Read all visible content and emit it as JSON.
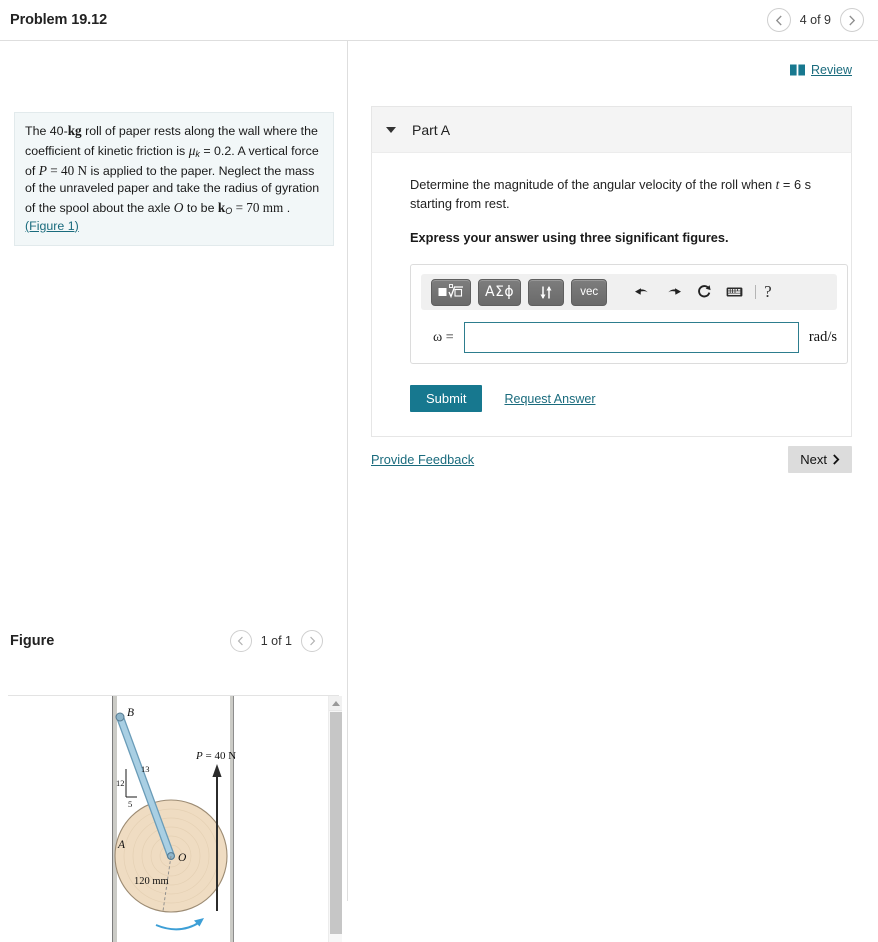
{
  "header": {
    "problem_title": "Problem 19.12",
    "prev_icon": "chevron-left-icon",
    "next_icon": "chevron-right-icon",
    "pager_label": "4 of 9"
  },
  "review": {
    "icon": "book-icon",
    "label": "Review",
    "color": "#1a6b7d"
  },
  "problem_statement": {
    "line1_a": "The 40-",
    "line1_kg": "kg",
    "line1_b": " roll of paper rests along the wall where the coefficient of kinetic friction is ",
    "mu_k": "μ",
    "mu_sub": "k",
    "eq_mu": " = 0.2. A vertical force of ",
    "P": "P",
    "P_val": " = 40 N",
    "after_P": " is applied to the paper. Neglect the mass of the unraveled paper and take the radius of gyration of the spool about the axle ",
    "O": "O",
    "to_be": " to be ",
    "k_O": "k",
    "k_sub": "O",
    "k_val": " = 70  mm",
    "period": " . ",
    "figure_link": "(Figure 1)"
  },
  "part": {
    "caret_icon": "caret-down-icon",
    "label": "Part A",
    "question_a": "Determine the magnitude of the angular velocity of the roll when ",
    "question_t": "t",
    "question_t_val": " = 6  s starting from rest.",
    "instruction": "Express your answer using three significant figures."
  },
  "math_toolbar": {
    "buttons": [
      {
        "name": "template-radical-button",
        "label": "√"
      },
      {
        "name": "greek-letters-button",
        "label": "ΑΣϕ"
      },
      {
        "name": "sort-arrows-button",
        "label": "↓↑"
      },
      {
        "name": "vector-button",
        "label": "vec"
      }
    ],
    "icons": [
      {
        "name": "undo-icon",
        "label": "undo"
      },
      {
        "name": "redo-icon",
        "label": "redo"
      },
      {
        "name": "reset-icon",
        "label": "reset"
      },
      {
        "name": "keyboard-icon",
        "label": "keyboard"
      }
    ],
    "help_label": "?"
  },
  "answer": {
    "variable_label": "ω =",
    "value": "",
    "placeholder": "",
    "unit": "rad/s",
    "border_color": "#2d7d8e"
  },
  "actions": {
    "submit_label": "Submit",
    "request_answer_label": "Request Answer",
    "submit_color": "#17788f"
  },
  "footer": {
    "feedback_label": "Provide Feedback",
    "next_label": "Next",
    "next_icon": "chevron-right-icon"
  },
  "figure_panel": {
    "title": "Figure",
    "prev_icon": "chevron-left-icon",
    "next_icon": "chevron-right-icon",
    "pager_label": "1 of 1",
    "scroll_up_icon": "triangle-up-icon"
  },
  "figure_diagram": {
    "point_B": "B",
    "point_A": "A",
    "point_O": "O",
    "triangle_12": "12",
    "triangle_13": "13",
    "triangle_5": "5",
    "force_label": "P = 40 N",
    "radius_label": "120 mm",
    "wall_color": "#c9c9c4",
    "bar_color": "#a9cfe3",
    "roll_color": "#efdcc2",
    "arrow_color": "#3d9fd6"
  }
}
